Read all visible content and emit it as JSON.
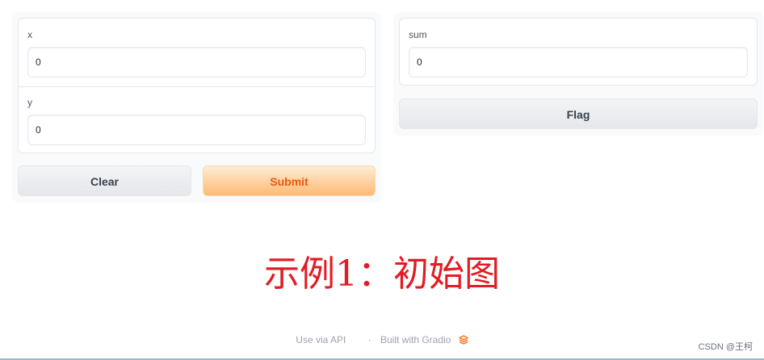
{
  "inputs": {
    "x": {
      "label": "x",
      "value": "0"
    },
    "y": {
      "label": "y",
      "value": "0"
    }
  },
  "actions": {
    "clear_label": "Clear",
    "submit_label": "Submit"
  },
  "output": {
    "sum": {
      "label": "sum",
      "value": "0"
    },
    "flag_label": "Flag"
  },
  "caption": "示例1：初始图",
  "footer": {
    "api_link": "Use via API",
    "separator": "·",
    "built_with": "Built with Gradio",
    "logo_icon": "gradio-logo-icon"
  },
  "watermark": "CSDN @王柯",
  "colors": {
    "primary_text": "#ea580c",
    "primary_bg": "#fdba74",
    "caption": "#e31b23"
  }
}
